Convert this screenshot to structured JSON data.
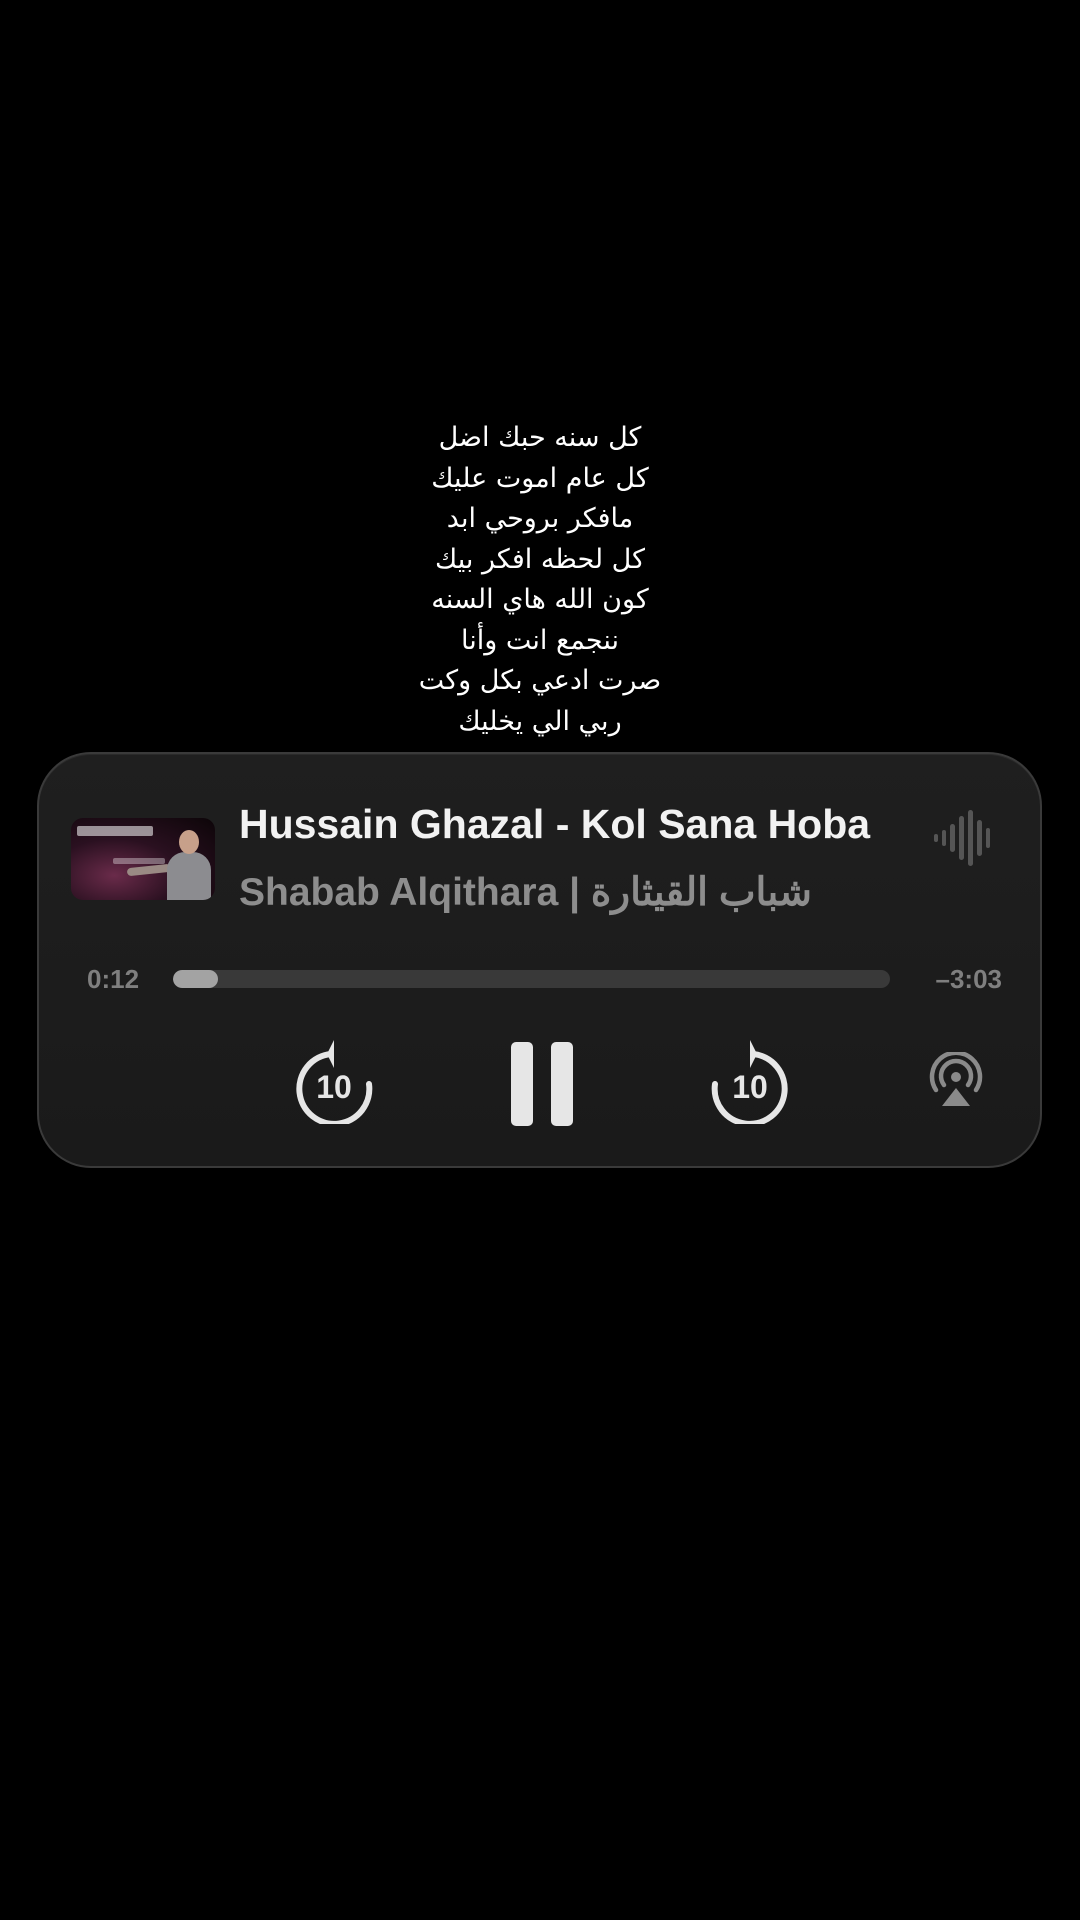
{
  "lyrics": [
    "كل سنه حبك اضل",
    "كل عام اموت عليك",
    "مافكر بروحي ابد",
    "كل لحظه افكر بيك",
    "كون الله هاي السنه",
    "ننجمع انت وأنا",
    "صرت ادعي بكل وكت",
    "ربي الي يخليك"
  ],
  "player": {
    "title": "Hussain Ghazal - Kol Sana Hoba",
    "artist": "Shabab Alqithara | شباب القيثارة",
    "elapsed": "0:12",
    "remaining": "–3:03",
    "progress": 0.063,
    "skip_back_seconds": "10",
    "skip_forward_seconds": "10",
    "icons": {
      "artwork": "album-artwork",
      "waveform": "waveform-icon",
      "skip_back": "skip-back-10-icon",
      "pause": "pause-icon",
      "skip_forward": "skip-forward-10-icon",
      "airplay": "airplay-audio-icon"
    }
  },
  "colors": {
    "background": "#000000",
    "card": "#1c1c1c",
    "title": "#f2f2f2",
    "secondary": "#8d8d8d",
    "controls": "#e6e6e6"
  }
}
